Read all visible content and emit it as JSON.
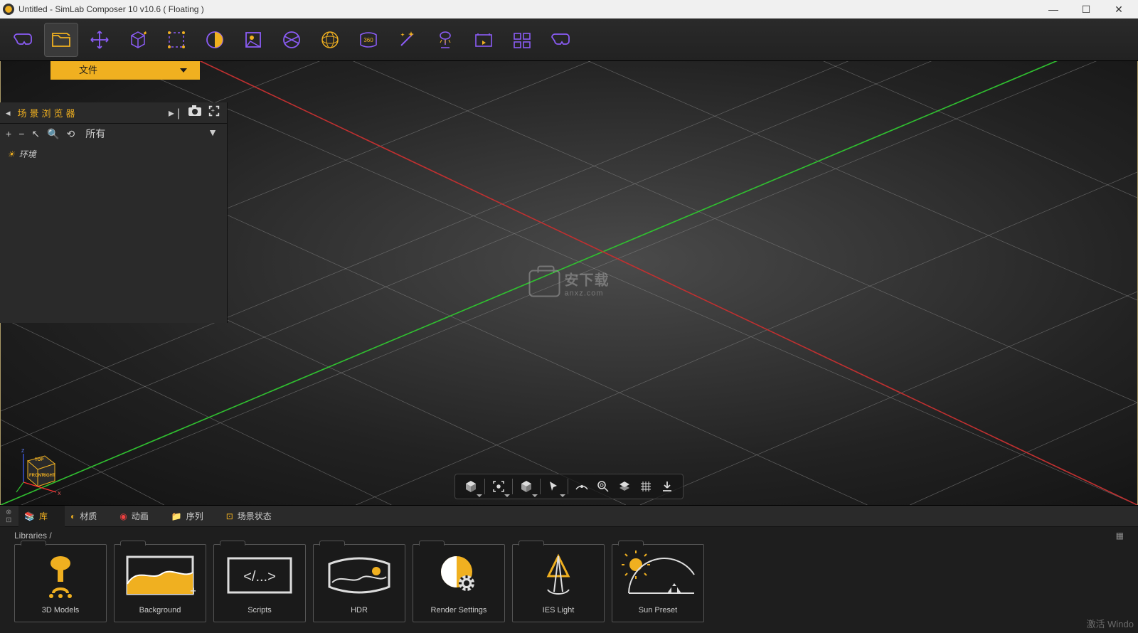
{
  "window": {
    "title": "Untitled - SimLab Composer 10 v10.6 ( Floating )"
  },
  "toolbar": {
    "items": [
      "vr-goggles",
      "file",
      "move",
      "geometry",
      "selection",
      "material",
      "texture",
      "uv",
      "globe",
      "panorama-360",
      "wand",
      "lamp",
      "timeline",
      "grid-layout",
      "vr-goggles-outline"
    ]
  },
  "tab_row": {
    "file_label": "文件"
  },
  "scene_browser": {
    "title": "场景浏览器",
    "filter_label": "所有",
    "tree": {
      "item0": "环境"
    }
  },
  "watermark": {
    "main": "安下载",
    "sub": "anxz.com"
  },
  "bottom_tabs": {
    "t0": "库",
    "t1": "材质",
    "t2": "动画",
    "t3": "序列",
    "t4": "场景状态"
  },
  "breadcrumb": {
    "path": "Libraries  /"
  },
  "library": {
    "c0": "3D Models",
    "c1": "Background",
    "c2": "Scripts",
    "c3": "HDR",
    "c4": "Render Settings",
    "c5": "IES Light",
    "c6": "Sun Preset"
  },
  "activate": {
    "l1": "激活 Windo",
    "l2": ""
  }
}
